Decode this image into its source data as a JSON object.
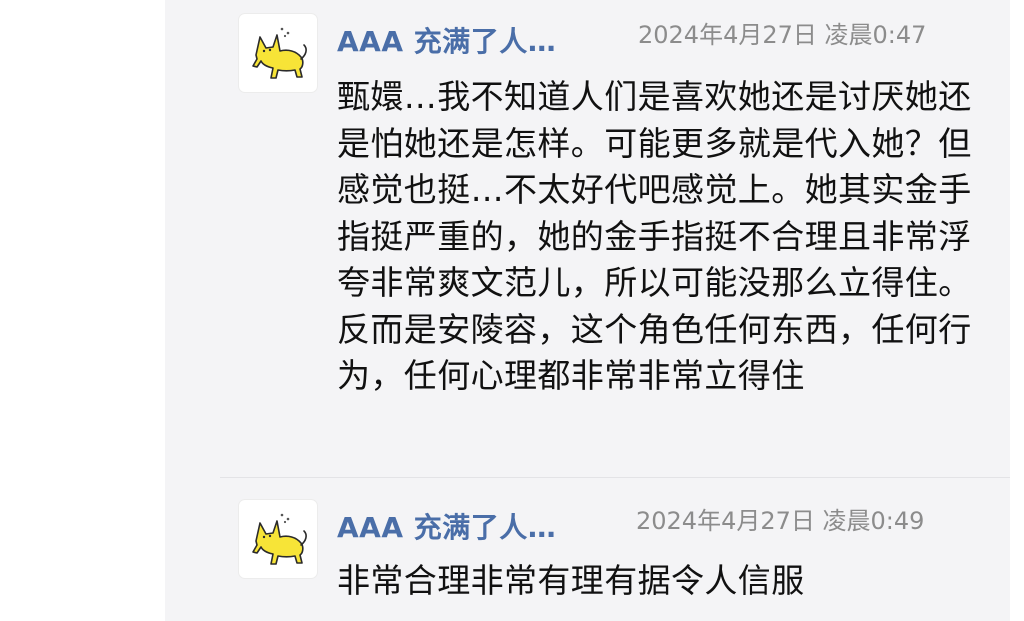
{
  "comments": [
    {
      "author": "AAA 充满了人…",
      "timestamp": "2024年4月27日 凌晨0:47",
      "avatar_icon": "yellow-cat-icon",
      "text": "甄嬛…我不知道人们是喜欢她还是讨厌她还是怕她还是怎样。可能更多就是代入她？但感觉也挺…不太好代吧感觉上。她其实金手指挺严重的，她的金手指挺不合理且非常浮夸非常爽文范儿，所以可能没那么立得住。反而是安陵容，这个角色任何东西，任何行为，任何心理都非常非常立得住"
    },
    {
      "author": "AAA 充满了人…",
      "timestamp": "2024年4月27日 凌晨0:49",
      "avatar_icon": "yellow-cat-icon",
      "text": "非常合理非常有理有据令人信服"
    }
  ],
  "colors": {
    "panel_bg": "#f4f4f6",
    "author": "#4a6ea8",
    "timestamp": "#8c8c8c",
    "text": "#111111",
    "cat": "#f7e437"
  }
}
